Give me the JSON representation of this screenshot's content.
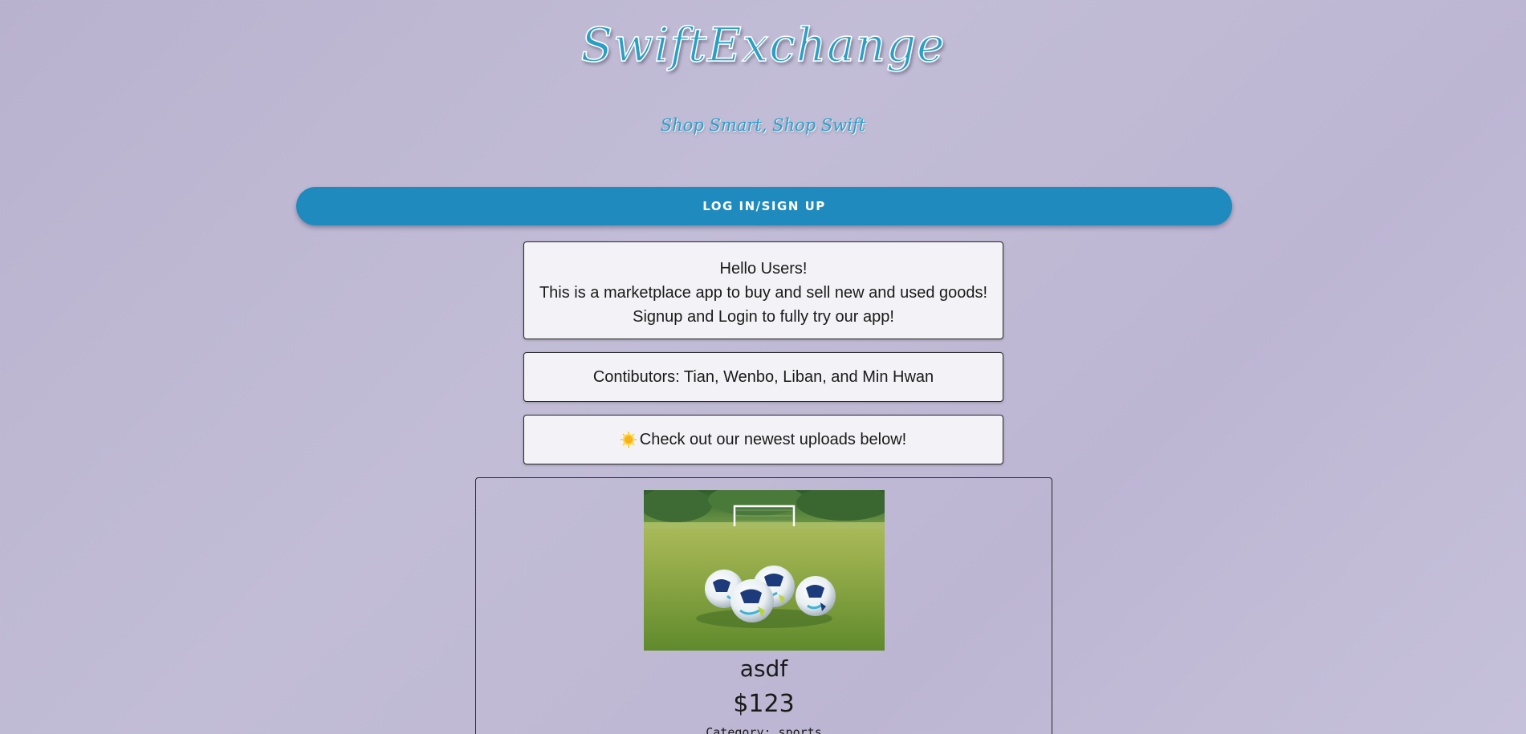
{
  "header": {
    "logo_text": "SwiftExchange",
    "tagline": "Shop Smart, Shop Swift"
  },
  "auth": {
    "login_label": "LOG IN/SIGN UP"
  },
  "welcome": {
    "line1": "Hello Users!",
    "line2": "This is a marketplace app to buy and sell new and used goods!",
    "line3": "Signup and Login to fully try our app!"
  },
  "contributors": {
    "text": "Contibutors: Tian, Wenbo, Liban, and Min Hwan"
  },
  "newest": {
    "icon": "sun-icon",
    "text": "Check out our newest uploads below!"
  },
  "products": [
    {
      "image": "soccer-balls-on-field-photo",
      "name": "asdf",
      "price": "$123",
      "category": "Category: sports"
    }
  ],
  "colors": {
    "accent": "#1e8abd",
    "logo": "#2a9fc4",
    "background": "#bdb6d3",
    "card": "#f3f2f7"
  }
}
